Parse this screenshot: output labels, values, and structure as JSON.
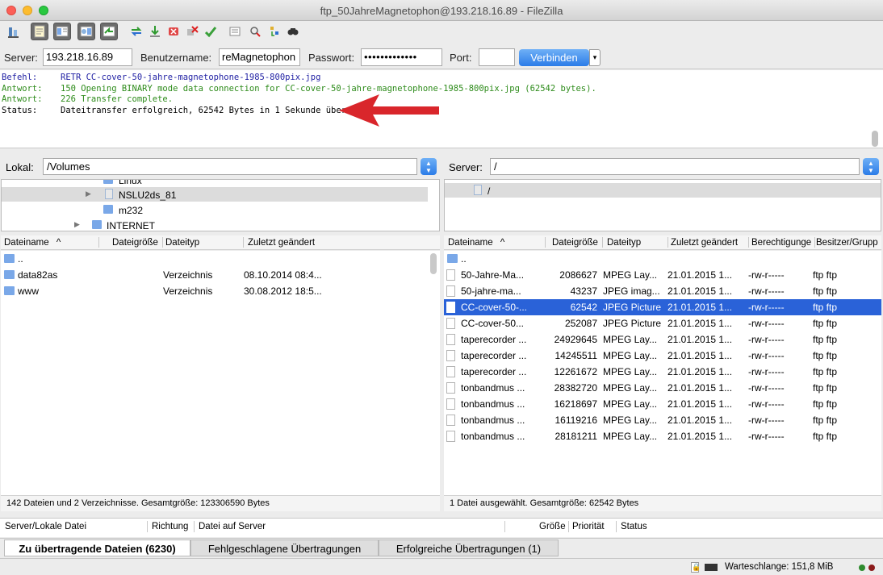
{
  "window": {
    "title": "ftp_50JahreMagnetophon@193.218.16.89 - FileZilla"
  },
  "toolbar": {
    "icons": [
      "site-manager-icon",
      "toggle-log-icon",
      "toggle-local-tree-icon",
      "toggle-remote-tree-icon",
      "toggle-queue-icon",
      "refresh-icon",
      "process-queue-icon",
      "cancel-icon",
      "disconnect-icon",
      "reconnect-icon",
      "filter-icon",
      "compare-icon",
      "sync-browse-icon",
      "search-icon"
    ]
  },
  "quickconnect": {
    "server_label": "Server:",
    "server_value": "193.218.16.89",
    "user_label": "Benutzername:",
    "user_value": "reMagnetophon",
    "password_label": "Passwort:",
    "password_value": "•••••••••••••",
    "port_label": "Port:",
    "port_value": "",
    "connect_label": "Verbinden",
    "connect_dropdown": "▾"
  },
  "log": [
    {
      "type": "Befehl:",
      "msg": "RETR CC-cover-50-jahre-magnetophone-1985-800pix.jpg",
      "kind": "cmd"
    },
    {
      "type": "Antwort:",
      "msg": "150 Opening BINARY mode data connection for CC-cover-50-jahre-magnetophone-1985-800pix.jpg (62542 bytes).",
      "kind": "resp"
    },
    {
      "type": "Antwort:",
      "msg": "226 Transfer complete.",
      "kind": "resp"
    },
    {
      "type": "Status:",
      "msg": "Dateitransfer erfolgreich, 62542 Bytes in 1 Sekunde übertragen",
      "kind": "status"
    }
  ],
  "local": {
    "path_label": "Lokal:",
    "path_value": "/Volumes",
    "tree": [
      {
        "label": "Linux",
        "kind": "folder"
      },
      {
        "label": "NSLU2ds_81",
        "kind": "drive",
        "selected": true,
        "expandable": true
      },
      {
        "label": "m232",
        "kind": "folder"
      },
      {
        "label": "INTERNET",
        "kind": "folder",
        "expandable": true
      }
    ],
    "columns": [
      "Dateiname",
      "Dateigröße",
      "Dateityp",
      "Zuletzt geändert"
    ],
    "sort_indicator": "^",
    "rows": [
      {
        "name": "..",
        "size": "",
        "type": "",
        "modified": ""
      },
      {
        "name": "data82as",
        "size": "",
        "type": "Verzeichnis",
        "modified": "08.10.2014 08:4..."
      },
      {
        "name": "www",
        "size": "",
        "type": "Verzeichnis",
        "modified": "30.08.2012 18:5..."
      }
    ],
    "status": "142 Dateien und 2 Verzeichnisse. Gesamtgröße: 123306590 Bytes"
  },
  "remote": {
    "path_label": "Server:",
    "path_value": "/",
    "tree": [
      {
        "label": "/",
        "kind": "drive",
        "selected": true
      }
    ],
    "columns": [
      "Dateiname",
      "Dateigröße",
      "Dateityp",
      "Zuletzt geändert",
      "Berechtigunge",
      "Besitzer/Grupp"
    ],
    "sort_indicator": "^",
    "rows": [
      {
        "name": "..",
        "size": "",
        "type": "",
        "modified": "",
        "perm": "",
        "owner": "",
        "dir": true
      },
      {
        "name": "50-Jahre-Ma...",
        "size": "2086627",
        "type": "MPEG Lay...",
        "modified": "21.01.2015 1...",
        "perm": "-rw-r-----",
        "owner": "ftp ftp"
      },
      {
        "name": "50-jahre-ma...",
        "size": "43237",
        "type": "JPEG imag...",
        "modified": "21.01.2015 1...",
        "perm": "-rw-r-----",
        "owner": "ftp ftp"
      },
      {
        "name": "CC-cover-50-...",
        "size": "62542",
        "type": "JPEG Picture",
        "modified": "21.01.2015 1...",
        "perm": "-rw-r-----",
        "owner": "ftp ftp",
        "selected": true
      },
      {
        "name": "CC-cover-50...",
        "size": "252087",
        "type": "JPEG Picture",
        "modified": "21.01.2015 1...",
        "perm": "-rw-r-----",
        "owner": "ftp ftp"
      },
      {
        "name": "taperecorder ...",
        "size": "24929645",
        "type": "MPEG Lay...",
        "modified": "21.01.2015 1...",
        "perm": "-rw-r-----",
        "owner": "ftp ftp"
      },
      {
        "name": "taperecorder ...",
        "size": "14245511",
        "type": "MPEG Lay...",
        "modified": "21.01.2015 1...",
        "perm": "-rw-r-----",
        "owner": "ftp ftp"
      },
      {
        "name": "taperecorder ...",
        "size": "12261672",
        "type": "MPEG Lay...",
        "modified": "21.01.2015 1...",
        "perm": "-rw-r-----",
        "owner": "ftp ftp"
      },
      {
        "name": "tonbandmus ...",
        "size": "28382720",
        "type": "MPEG Lay...",
        "modified": "21.01.2015 1...",
        "perm": "-rw-r-----",
        "owner": "ftp ftp"
      },
      {
        "name": "tonbandmus ...",
        "size": "16218697",
        "type": "MPEG Lay...",
        "modified": "21.01.2015 1...",
        "perm": "-rw-r-----",
        "owner": "ftp ftp"
      },
      {
        "name": "tonbandmus ...",
        "size": "16119216",
        "type": "MPEG Lay...",
        "modified": "21.01.2015 1...",
        "perm": "-rw-r-----",
        "owner": "ftp ftp"
      },
      {
        "name": "tonbandmus ...",
        "size": "28181211",
        "type": "MPEG Lay...",
        "modified": "21.01.2015 1...",
        "perm": "-rw-r-----",
        "owner": "ftp ftp"
      }
    ],
    "status": "1 Datei ausgewählt. Gesamtgröße: 62542 Bytes"
  },
  "queue": {
    "columns": [
      "Server/Lokale Datei",
      "Richtung",
      "Datei auf Server",
      "Größe",
      "Priorität",
      "Status"
    ]
  },
  "tabs": [
    {
      "label": "Zu übertragende Dateien (6230)",
      "active": true
    },
    {
      "label": "Fehlgeschlagene Übertragungen",
      "active": false
    },
    {
      "label": "Erfolgreiche Übertragungen (1)",
      "active": false
    }
  ],
  "statusbar": {
    "queue": "Warteschlange: 151,8 MiB"
  },
  "colors": {
    "selection": "#2a62d8",
    "annotation_arrow": "#d9262b",
    "accent": "#2b7ce8"
  }
}
